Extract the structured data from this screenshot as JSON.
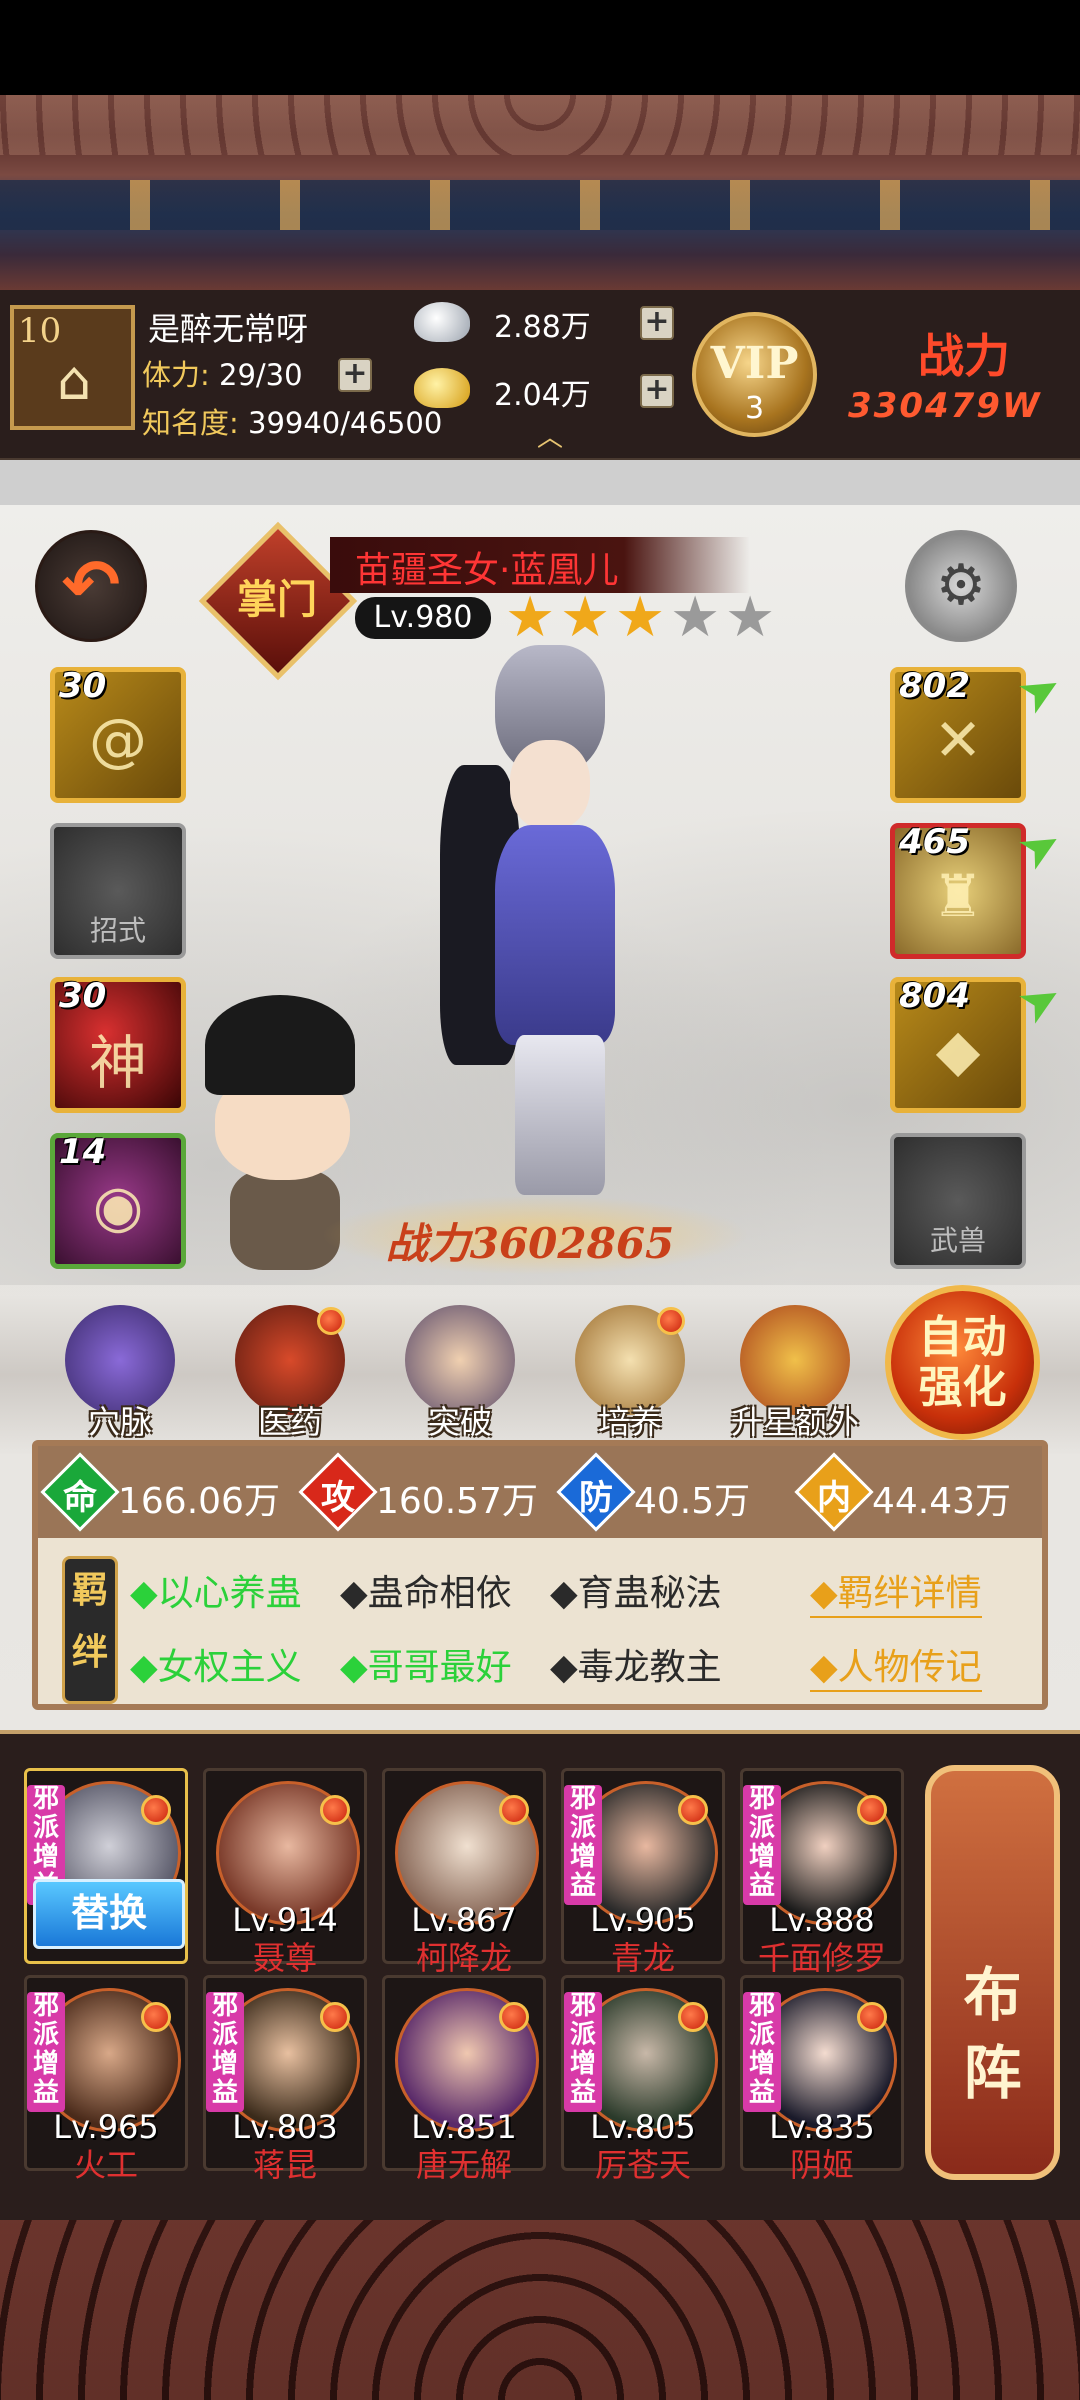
{
  "topbar": {
    "player_level": "10",
    "player_name": "是醉无常呀",
    "stamina_label": "体力:",
    "stamina_value": "29/30",
    "fame_label": "知名度:",
    "fame_value": "39940/46500",
    "silver": "2.88万",
    "gold": "2.04万",
    "vip_text": "VIP",
    "vip_level": "3",
    "power_label": "战力",
    "power_value": "330479W"
  },
  "hero": {
    "rank": "掌门",
    "name": "苗疆圣女·蓝凰儿",
    "level": "Lv.980",
    "stars_total": 5,
    "stars_filled": 3,
    "power": "战力3602865"
  },
  "left_slots": [
    {
      "num": "30",
      "label": ""
    },
    {
      "num": "",
      "label": "招式"
    },
    {
      "num": "30",
      "label": "",
      "glyph": "神"
    },
    {
      "num": "14",
      "label": ""
    }
  ],
  "right_slots": [
    {
      "num": "802",
      "label": ""
    },
    {
      "num": "465",
      "label": ""
    },
    {
      "num": "804",
      "label": ""
    },
    {
      "num": "",
      "label": "武兽"
    }
  ],
  "functions": [
    {
      "label": "穴脉",
      "dot": false
    },
    {
      "label": "医药",
      "dot": true
    },
    {
      "label": "突破",
      "dot": false
    },
    {
      "label": "培养",
      "dot": true
    },
    {
      "label": "升星额外",
      "dot": false
    }
  ],
  "auto_button": {
    "line1": "自动",
    "line2": "强化"
  },
  "stats": [
    {
      "icon": "命",
      "value": "166.06万",
      "color": "#1aa83a"
    },
    {
      "icon": "攻",
      "value": "160.57万",
      "color": "#d8281a"
    },
    {
      "icon": "防",
      "value": "40.5万",
      "color": "#1a6ad8"
    },
    {
      "icon": "内",
      "value": "44.43万",
      "color": "#e8a01a"
    }
  ],
  "bonds": {
    "seal": "羁绊",
    "row1": [
      {
        "text": "◆以心养蛊",
        "active": true
      },
      {
        "text": "◆蛊命相依",
        "active": false
      },
      {
        "text": "◆育蛊秘法",
        "active": false
      }
    ],
    "row2": [
      {
        "text": "◆女权主义",
        "active": true
      },
      {
        "text": "◆哥哥最好",
        "active": true
      },
      {
        "text": "◆毒龙教主",
        "active": false
      }
    ],
    "link1": "◆羁绊详情",
    "link2": "◆人物传记"
  },
  "roster": [
    {
      "level": "",
      "name": "",
      "tag": "邪派增益",
      "current": true,
      "swap": "替换"
    },
    {
      "level": "Lv.914",
      "name": "聂尊",
      "tag": ""
    },
    {
      "level": "Lv.867",
      "name": "柯降龙",
      "tag": ""
    },
    {
      "level": "Lv.905",
      "name": "青龙",
      "tag": "邪派增益"
    },
    {
      "level": "Lv.888",
      "name": "千面修罗",
      "tag": "邪派增益"
    },
    {
      "level": "Lv.965",
      "name": "火工",
      "tag": "邪派增益"
    },
    {
      "level": "Lv.803",
      "name": "蒋昆",
      "tag": "邪派增益"
    },
    {
      "level": "Lv.851",
      "name": "唐无解",
      "tag": ""
    },
    {
      "level": "Lv.805",
      "name": "厉苍天",
      "tag": "邪派增益"
    },
    {
      "level": "Lv.835",
      "name": "阴姬",
      "tag": "邪派增益"
    }
  ],
  "formation": {
    "line1": "布",
    "line2": "阵"
  }
}
